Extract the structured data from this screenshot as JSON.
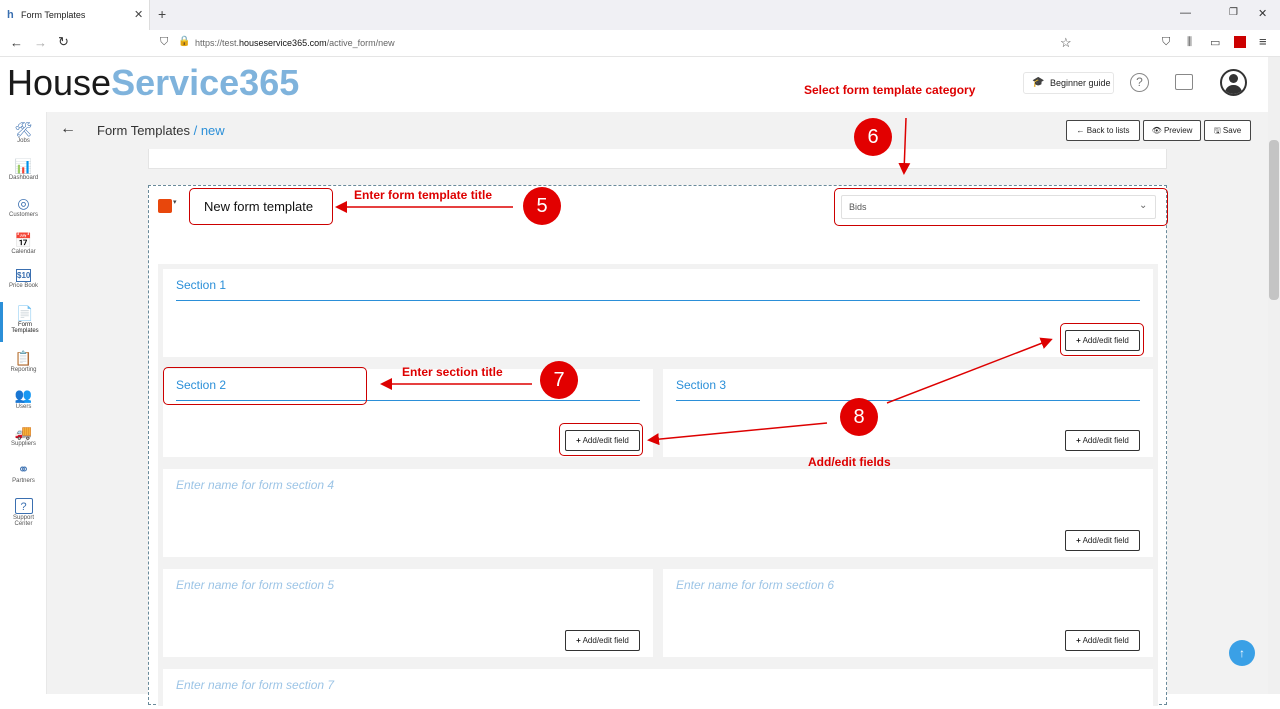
{
  "browser": {
    "tab_title": "Form Templates",
    "new_tab_label": "+",
    "url_prefix": "https://test.",
    "url_domain": "houseservice365.com",
    "url_path": "/active_form/new"
  },
  "header": {
    "logo_part1": "House",
    "logo_part2": "Service365",
    "beginner_guide_label": "Beginner guide",
    "help_label": "?"
  },
  "sidebar": {
    "items": [
      {
        "label": "Jobs",
        "icon": "🛠"
      },
      {
        "label": "Dashboard",
        "icon": "📊"
      },
      {
        "label": "Customers",
        "icon": "◎"
      },
      {
        "label": "Calendar",
        "icon": "📅"
      },
      {
        "label": "Price Book",
        "icon": "$10"
      },
      {
        "label": "Form Templates",
        "icon": "📄"
      },
      {
        "label": "Reporting",
        "icon": "📋"
      },
      {
        "label": "Users",
        "icon": "👥"
      },
      {
        "label": "Suppliers",
        "icon": "🚚"
      },
      {
        "label": "Partners",
        "icon": "⚭"
      },
      {
        "label": "Support Center",
        "icon": "?"
      }
    ]
  },
  "toolbar": {
    "breadcrumb_root": "Form Templates",
    "breadcrumb_sep": " / ",
    "breadcrumb_current": "new",
    "back_to_lists_label": "Back to lists",
    "preview_label": "Preview",
    "save_label": "Save"
  },
  "form": {
    "template_title": "New form template",
    "category_value": "Bids",
    "add_field_label": "Add/edit field",
    "sections": [
      {
        "title": "Section 1"
      },
      {
        "title": "Section 2"
      },
      {
        "title": "Section 3"
      },
      {
        "placeholder": "Enter name for form section 4"
      },
      {
        "placeholder": "Enter name for form section 5"
      },
      {
        "placeholder": "Enter name for form section 6"
      },
      {
        "placeholder": "Enter name for form section 7"
      }
    ]
  },
  "annotations": {
    "select_category": "Select form template category",
    "enter_title": "Enter form template title",
    "enter_section_title": "Enter section title",
    "add_edit_fields": "Add/edit fields",
    "step5": "5",
    "step6": "6",
    "step7": "7",
    "step8": "8"
  },
  "colors": {
    "accent_blue": "#2b8fd8",
    "annotation_red": "#e20000",
    "color_swatch": "#e8470c"
  }
}
